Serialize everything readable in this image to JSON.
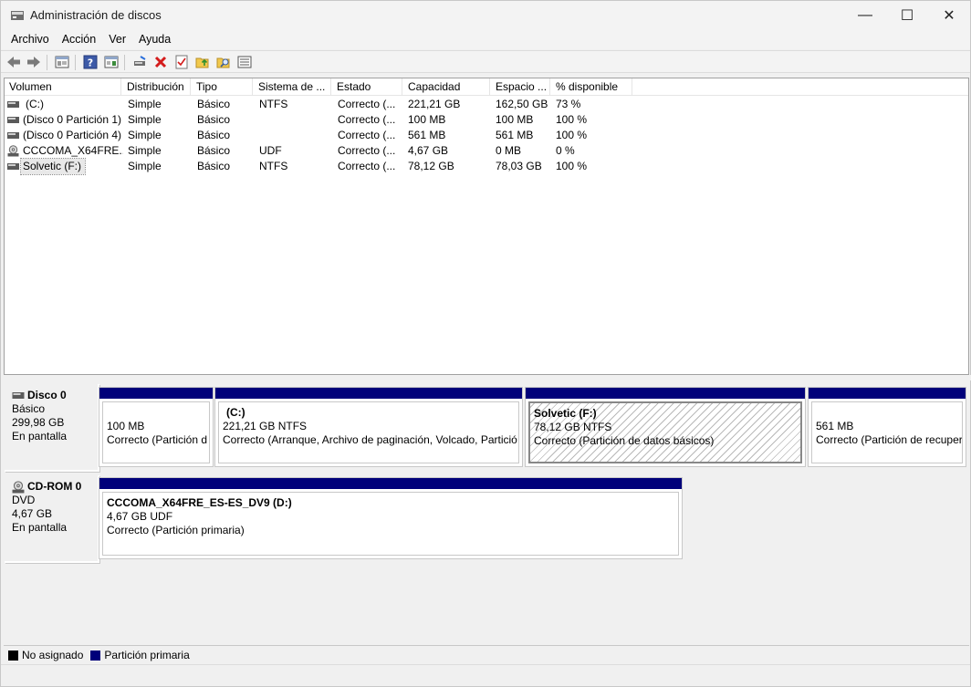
{
  "window": {
    "title": "Administración de discos",
    "minimize_glyph": "—",
    "maximize_glyph": "☐",
    "close_glyph": "✕"
  },
  "menu": [
    "Archivo",
    "Acción",
    "Ver",
    "Ayuda"
  ],
  "toolbar_icons": [
    "back-arrow-icon",
    "forward-arrow-icon",
    "console-tree-icon",
    "help-icon",
    "show-hide-icon",
    "connect-drive-icon",
    "delete-icon",
    "properties-check-icon",
    "upload-folder-icon",
    "search-folder-icon",
    "list-view-icon"
  ],
  "list": {
    "columns": [
      "Volumen",
      "Distribución",
      "Tipo",
      "Sistema de ...",
      "Estado",
      "Capacidad",
      "Espacio ...",
      "% disponible"
    ],
    "rows": [
      {
        "volume": "(C:)",
        "layout": "Simple",
        "type": "Básico",
        "fs": "NTFS",
        "status": "Correcto (...",
        "capacity": "221,21 GB",
        "free": "162,50 GB",
        "pct": "73 %",
        "icon": "hard-drive-icon"
      },
      {
        "volume": "(Disco 0 Partición 1)",
        "layout": "Simple",
        "type": "Básico",
        "fs": "",
        "status": "Correcto (...",
        "capacity": "100 MB",
        "free": "100 MB",
        "pct": "100 %",
        "icon": "hard-drive-icon"
      },
      {
        "volume": "(Disco 0 Partición 4)",
        "layout": "Simple",
        "type": "Básico",
        "fs": "",
        "status": "Correcto (...",
        "capacity": "561 MB",
        "free": "561 MB",
        "pct": "100 %",
        "icon": "hard-drive-icon"
      },
      {
        "volume": "CCCOMA_X64FRE...",
        "layout": "Simple",
        "type": "Básico",
        "fs": "UDF",
        "status": "Correcto (...",
        "capacity": "4,67 GB",
        "free": "0 MB",
        "pct": "0 %",
        "icon": "cd-drive-icon"
      },
      {
        "volume": "Solvetic (F:)",
        "layout": "Simple",
        "type": "Básico",
        "fs": "NTFS",
        "status": "Correcto (...",
        "capacity": "78,12 GB",
        "free": "78,03 GB",
        "pct": "100 %",
        "icon": "hard-drive-icon"
      }
    ]
  },
  "disks": [
    {
      "name": "Disco 0",
      "kind": "Básico",
      "size": "299,98 GB",
      "state": "En pantalla",
      "partitions": [
        {
          "title": "",
          "size": "100 MB",
          "status": "Correcto (Partición d"
        },
        {
          "title": "(C:)",
          "size": "221,21 GB NTFS",
          "status": "Correcto (Arranque, Archivo de paginación, Volcado, Partició"
        },
        {
          "title": "Solvetic  (F:)",
          "size": "78,12 GB NTFS",
          "status": "Correcto (Partición de datos básicos)"
        },
        {
          "title": "",
          "size": "561 MB",
          "status": "Correcto (Partición de recuper"
        }
      ]
    },
    {
      "name": "CD-ROM 0",
      "kind": "DVD",
      "size": "4,67 GB",
      "state": "En pantalla",
      "partitions": [
        {
          "title": "CCCOMA_X64FRE_ES-ES_DV9  (D:)",
          "size": "4,67 GB UDF",
          "status": "Correcto (Partición primaria)"
        }
      ]
    }
  ],
  "legend": [
    {
      "label": "No asignado",
      "color": "#000000"
    },
    {
      "label": "Partición primaria",
      "color": "#00007a"
    }
  ],
  "colors": {
    "primary_partition": "#00007a",
    "unallocated": "#000000"
  }
}
